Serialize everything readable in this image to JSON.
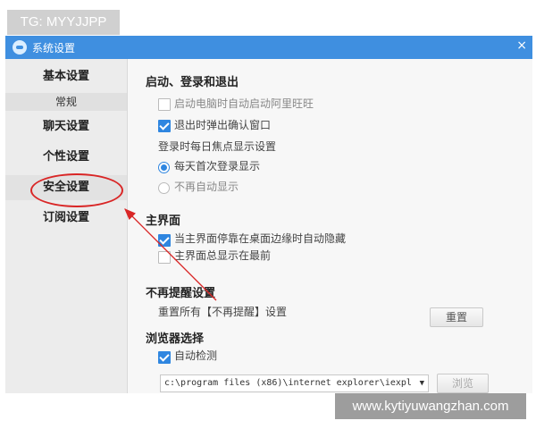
{
  "watermarks": {
    "top": "TG: MYYJJPP",
    "bottom": "www.kytiyuwangzhan.com"
  },
  "window": {
    "title": "系统设置",
    "close_glyph": "×",
    "titlebar_color": "#3f8fe0"
  },
  "sidebar": {
    "items": [
      {
        "label": "基本设置"
      },
      {
        "label": "常规"
      },
      {
        "label": "聊天设置"
      },
      {
        "label": "个性设置"
      },
      {
        "label": "安全设置"
      },
      {
        "label": "订阅设置"
      }
    ],
    "highlighted": "安全设置",
    "annotation_color": "#d92626"
  },
  "content": {
    "login": {
      "title": "启动、登录和退出",
      "opt_autostart": {
        "label": "启动电脑时自动启动阿里旺旺",
        "checked": false
      },
      "opt_confirm_exit": {
        "label": "退出时弹出确认窗口",
        "checked": true
      },
      "focus_label": "登录时每日焦点显示设置",
      "radio_first": {
        "label": "每天首次登录显示",
        "checked": true
      },
      "radio_never": {
        "label": "不再自动显示",
        "checked": false
      }
    },
    "main_ui": {
      "title": "主界面",
      "opt_autohide": {
        "label": "当主界面停靠在桌面边缘时自动隐藏",
        "checked": true
      },
      "opt_ontop": {
        "label": "主界面总显示在最前",
        "checked": false
      }
    },
    "reminders": {
      "title": "不再提醒设置",
      "desc": "重置所有【不再提醒】设置",
      "reset_button": "重置"
    },
    "browser": {
      "title": "浏览器选择",
      "opt_autodetect": {
        "label": "自动检测",
        "checked": true
      },
      "path_value": "c:\\program files (x86)\\internet explorer\\iexpl",
      "browse_button": "浏览"
    }
  },
  "accent_color": "#2f86e0"
}
